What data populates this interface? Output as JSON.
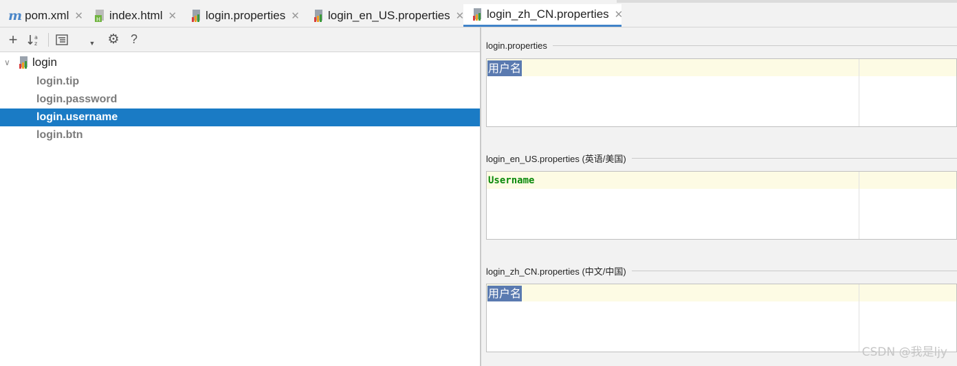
{
  "tabs": [
    {
      "label": "pom.xml",
      "icon": "maven-m-icon"
    },
    {
      "label": "index.html",
      "icon": "html-file-icon"
    },
    {
      "label": "login.properties",
      "icon": "properties-file-icon"
    },
    {
      "label": "login_en_US.properties",
      "icon": "properties-file-icon"
    },
    {
      "label": "login_zh_CN.properties",
      "icon": "properties-file-icon",
      "active": true
    }
  ],
  "toolbar": {
    "add": "+",
    "sort": "↓ᵃz",
    "group": "▤",
    "settings": "⚙",
    "help": "?"
  },
  "tree": {
    "root": "login",
    "keys": [
      "login.tip",
      "login.password",
      "login.username",
      "login.btn"
    ],
    "selected": "login.username"
  },
  "editors": [
    {
      "title": "login.properties",
      "value": "用户名"
    },
    {
      "title": "login_en_US.properties (英语/美国)",
      "value": "Username"
    },
    {
      "title": "login_zh_CN.properties (中文/中国)",
      "value": "用户名"
    }
  ],
  "watermark": "CSDN @我是ljy",
  "colors": {
    "selection": "#1a7bc5",
    "accent": "#4083c9",
    "highlight": "#5a7ab0",
    "string_green": "#0b8a0b"
  }
}
